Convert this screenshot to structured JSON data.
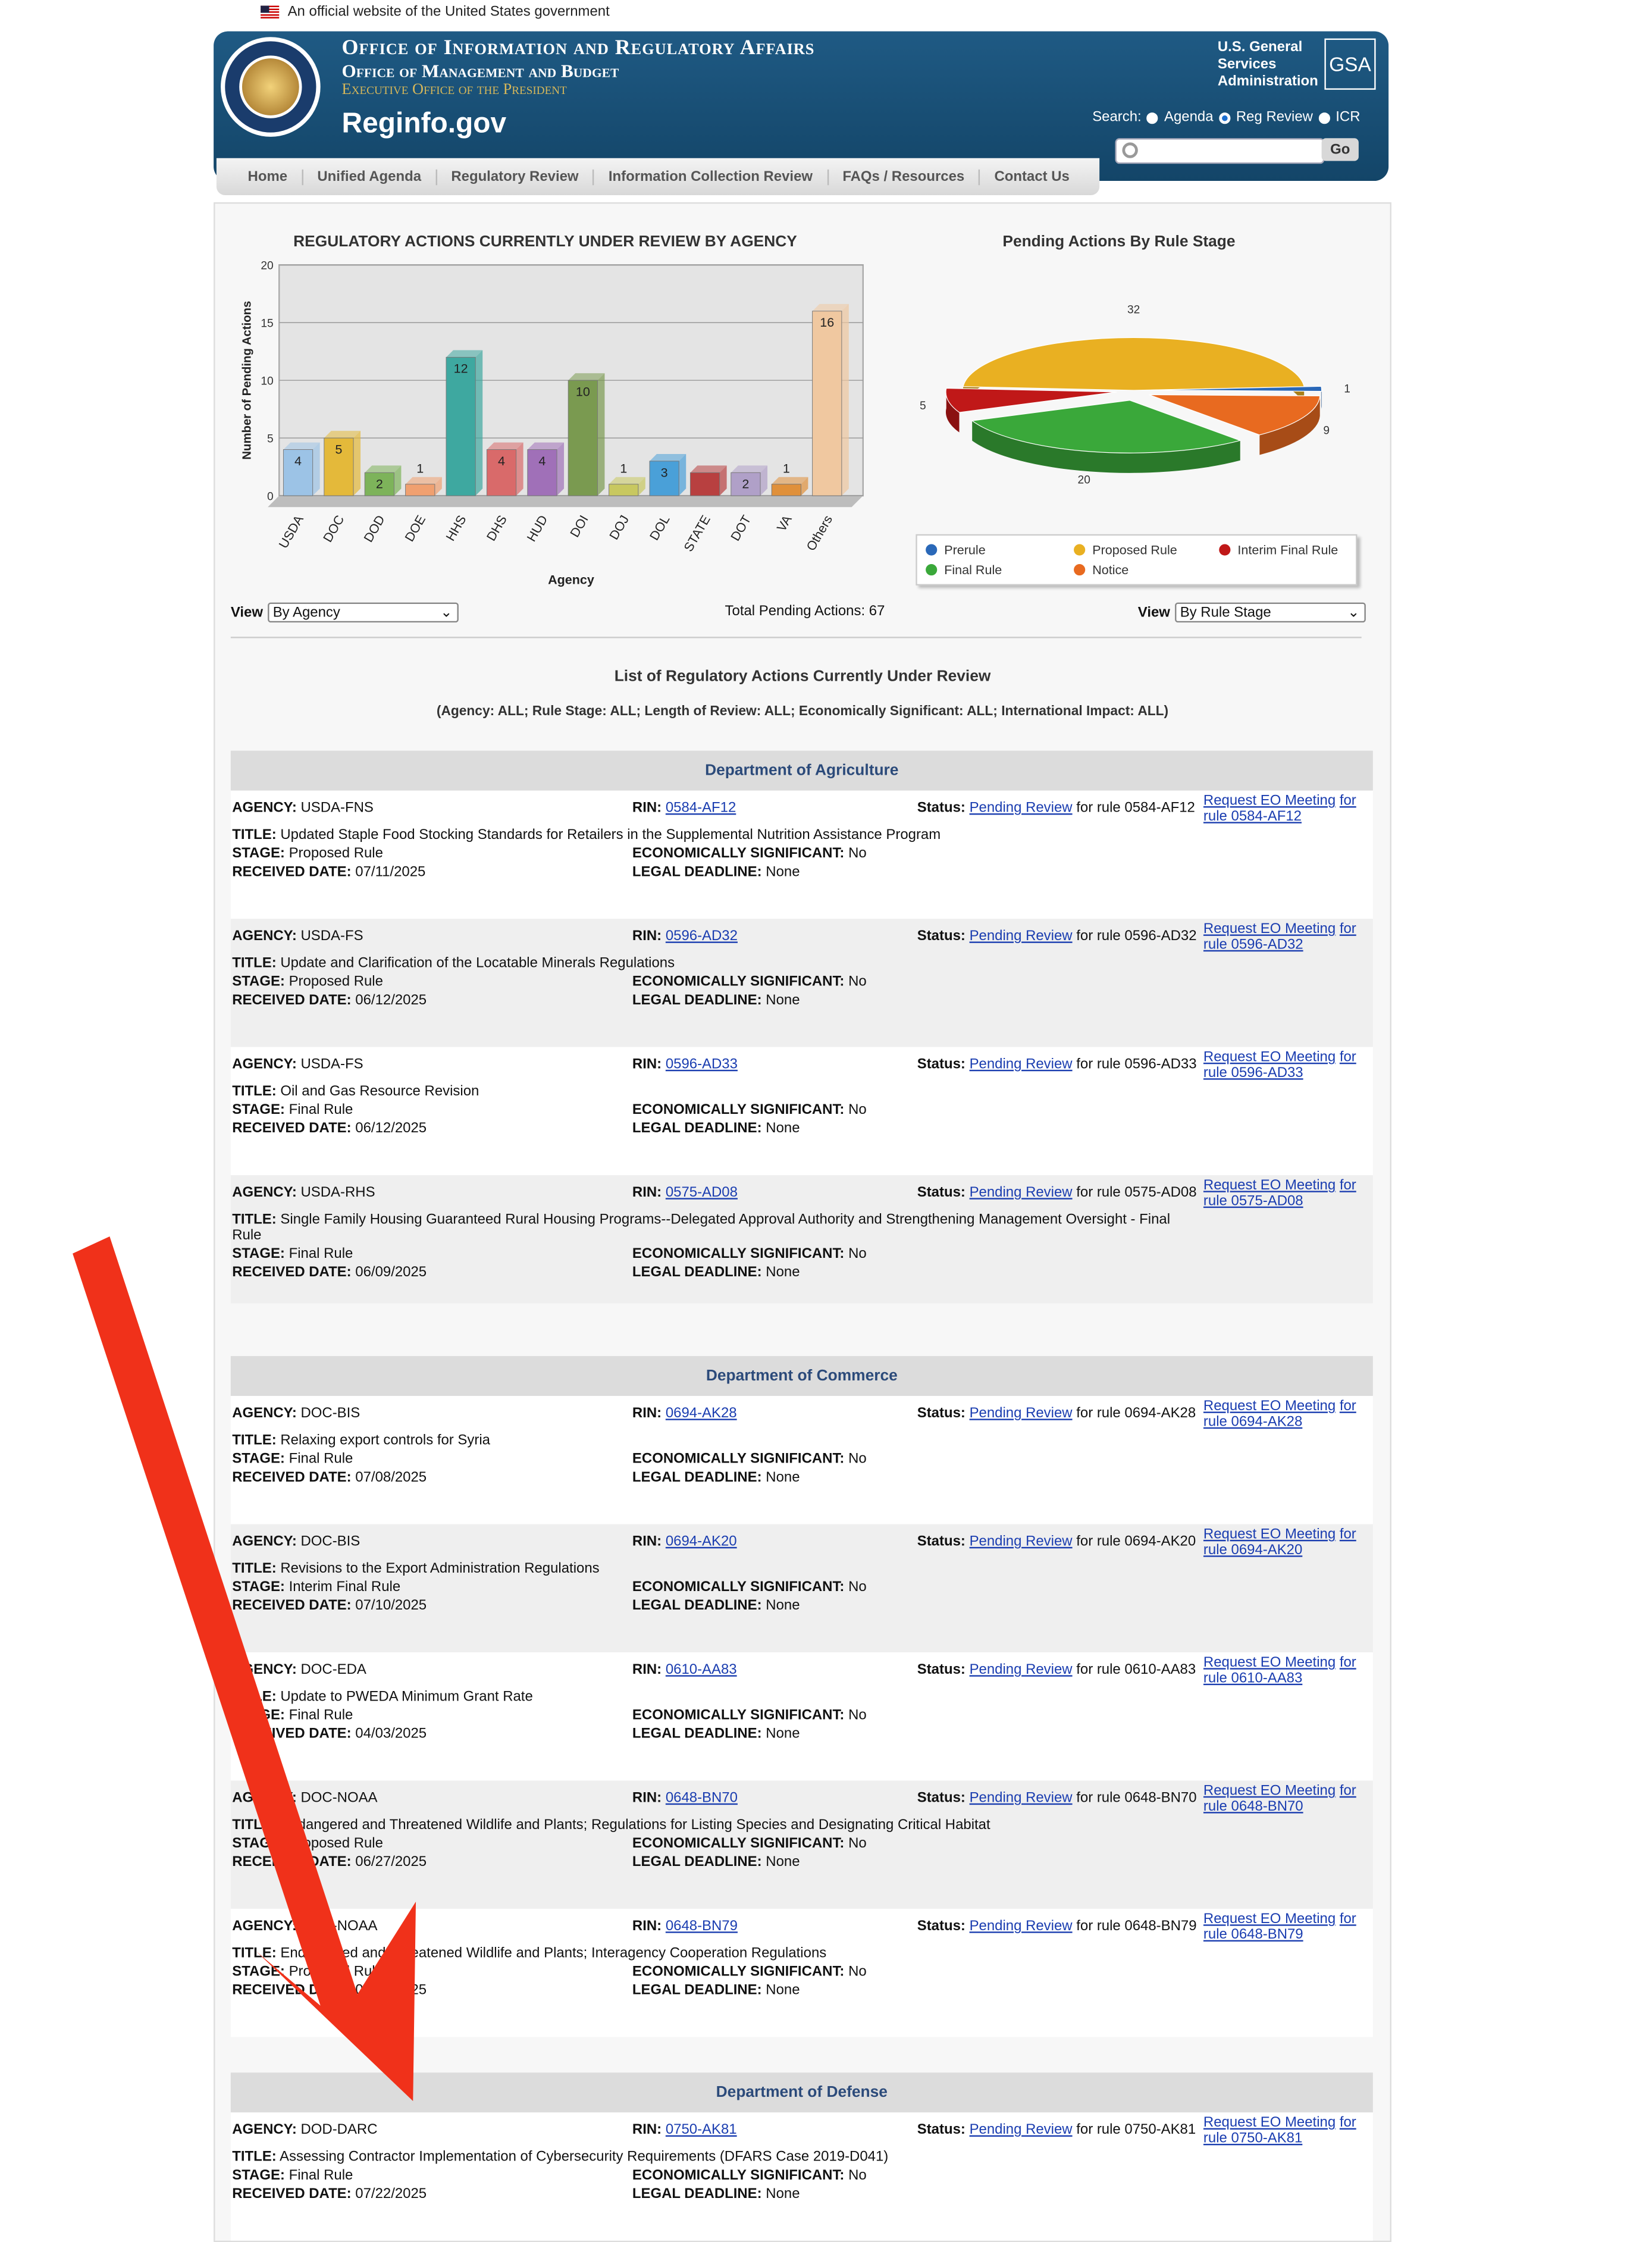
{
  "gov_banner": "An official website of the United States government",
  "header": {
    "title": "Office of Information and Regulatory Affairs",
    "subtitle": "Office of Management and Budget",
    "exec": "Executive Office of the President",
    "site": "Reginfo.gov",
    "gsa_text": "U.S. General Services Administration",
    "gsa_logo": "GSA",
    "search_label": "Search:",
    "search_options": [
      "Agenda",
      "Reg Review",
      "ICR"
    ],
    "search_selected": "Reg Review",
    "go_label": "Go"
  },
  "nav": [
    "Home",
    "Unified Agenda",
    "Regulatory Review",
    "Information Collection Review",
    "FAQs / Resources",
    "Contact Us"
  ],
  "bar_view": {
    "label": "View",
    "value": "By Agency"
  },
  "pie_view": {
    "label": "View",
    "value": "By Rule Stage"
  },
  "total_pending": "Total Pending Actions: 67",
  "chart_data": [
    {
      "type": "bar",
      "title": "REGULATORY ACTIONS CURRENTLY UNDER REVIEW BY AGENCY",
      "xlabel": "Agency",
      "ylabel": "Number of Pending Actions",
      "ylim": [
        0,
        20
      ],
      "yticks": [
        "0",
        "5",
        "10",
        "15",
        "20"
      ],
      "categories": [
        "USDA",
        "DOC",
        "DOD",
        "DOE",
        "HHS",
        "DHS",
        "HUD",
        "DOI",
        "DOJ",
        "DOL",
        "STATE",
        "DOT",
        "VA",
        "Others"
      ],
      "values": [
        4,
        5,
        2,
        1,
        12,
        4,
        4,
        10,
        1,
        3,
        2,
        2,
        1,
        16
      ],
      "labels": [
        "4",
        "5",
        "2",
        "1",
        "12",
        "4",
        "4",
        "10",
        "1",
        "3",
        "",
        "2",
        "1",
        "16"
      ],
      "colors": [
        "#9cc3e6",
        "#e4b93a",
        "#7db35a",
        "#f0a070",
        "#3ea8a0",
        "#d96a6a",
        "#a070b8",
        "#7a9a50",
        "#c8c860",
        "#4aa0d8",
        "#b84040",
        "#b0a0c8",
        "#e0903a",
        "#f0c8a0"
      ]
    },
    {
      "type": "pie",
      "title": "Pending Actions By Rule Stage",
      "slices": [
        {
          "label": "Proposed Rule",
          "value": 32,
          "color": "#e9b022"
        },
        {
          "label": "Prerule",
          "value": 1,
          "color": "#2a68b8"
        },
        {
          "label": "Notice",
          "value": 9,
          "color": "#e86a20"
        },
        {
          "label": "Final Rule",
          "value": 20,
          "color": "#3aa83a"
        },
        {
          "label": "Interim Final Rule",
          "value": 5,
          "color": "#c01818"
        }
      ],
      "value_labels": [
        "32",
        "1",
        "9",
        "20",
        "5"
      ],
      "legend": [
        "Prerule",
        "Proposed Rule",
        "Interim Final Rule",
        "Final Rule",
        "Notice"
      ]
    }
  ],
  "list_title": "List of Regulatory Actions Currently Under Review",
  "filters": "(Agency: ALL; Rule Stage: ALL; Length of Review: ALL; Economically Significant: ALL; International Impact: ALL)",
  "labels": {
    "agency": "AGENCY:",
    "rin": "RIN:",
    "status": "Status:",
    "pending": "Pending Review",
    "title": "TITLE:",
    "stage": "STAGE:",
    "received": "RECEIVED DATE:",
    "econ": "ECONOMICALLY SIGNIFICANT:",
    "legal": "LEGAL DEADLINE:",
    "request": "Request EO Meeting",
    "for": "for"
  },
  "departments": [
    {
      "name": "Department of Agriculture",
      "rows": [
        {
          "agency": "USDA-FNS",
          "rin": "0584-AF12",
          "status_suffix": "for rule 0584-AF12",
          "eo_rule": "rule 0584-AF12",
          "title": "Updated Staple Food Stocking Standards for Retailers in the Supplemental Nutrition Assistance Program",
          "title2": "",
          "stage": "Proposed Rule",
          "received": "07/11/2025",
          "econ": "No",
          "legal": "None"
        },
        {
          "agency": "USDA-FS",
          "rin": "0596-AD32",
          "status_suffix": "for rule 0596-AD32",
          "eo_rule": "rule 0596-AD32",
          "title": "Update and Clarification of the Locatable Minerals Regulations",
          "title2": "",
          "stage": "Proposed Rule",
          "received": "06/12/2025",
          "econ": "No",
          "legal": "None"
        },
        {
          "agency": "USDA-FS",
          "rin": "0596-AD33",
          "status_suffix": "for rule 0596-AD33",
          "eo_rule": "rule 0596-AD33",
          "title": "Oil and Gas Resource Revision",
          "title2": "",
          "stage": "Final Rule",
          "received": "06/12/2025",
          "econ": "No",
          "legal": "None"
        },
        {
          "agency": "USDA-RHS",
          "rin": "0575-AD08",
          "status_suffix": "for rule 0575-AD08",
          "eo_rule": "rule 0575-AD08",
          "title": "Single Family Housing Guaranteed Rural Housing Programs--Delegated Approval Authority and Strengthening Management Oversight - Final",
          "title2": "Rule",
          "stage": "Final Rule",
          "received": "06/09/2025",
          "econ": "No",
          "legal": "None"
        }
      ]
    },
    {
      "name": "Department of Commerce",
      "rows": [
        {
          "agency": "DOC-BIS",
          "rin": "0694-AK28",
          "status_suffix": "for rule 0694-AK28",
          "eo_rule": "rule 0694-AK28",
          "title": "Relaxing export controls for Syria",
          "title2": "",
          "stage": "Final Rule",
          "received": "07/08/2025",
          "econ": "No",
          "legal": "None"
        },
        {
          "agency": "DOC-BIS",
          "rin": "0694-AK20",
          "status_suffix": "for rule 0694-AK20",
          "eo_rule": "rule 0694-AK20",
          "title": "Revisions to the Export Administration Regulations",
          "title2": "",
          "stage": "Interim Final Rule",
          "received": "07/10/2025",
          "econ": "No",
          "legal": "None"
        },
        {
          "agency": "DOC-EDA",
          "rin": "0610-AA83",
          "status_suffix": "for rule 0610-AA83",
          "eo_rule": "rule 0610-AA83",
          "title": "Update to PWEDA Minimum Grant Rate",
          "title2": "",
          "stage": "Final Rule",
          "received": "04/03/2025",
          "econ": "No",
          "legal": "None"
        },
        {
          "agency": "DOC-NOAA",
          "rin": "0648-BN70",
          "status_suffix": "for rule 0648-BN70",
          "eo_rule": "rule 0648-BN70",
          "title": "Endangered and Threatened Wildlife and Plants; Regulations for Listing Species and Designating Critical Habitat",
          "title2": "",
          "stage": "Proposed Rule",
          "received": "06/27/2025",
          "econ": "No",
          "legal": "None"
        },
        {
          "agency": "DOC-NOAA",
          "rin": "0648-BN79",
          "status_suffix": "for rule 0648-BN79",
          "eo_rule": "rule 0648-BN79",
          "title": "Endangered and Threatened Wildlife and Plants; Interagency Cooperation Regulations",
          "title2": "",
          "stage": "Proposed Rule",
          "received": "06/27/2025",
          "econ": "No",
          "legal": "None"
        }
      ]
    },
    {
      "name": "Department of Defense",
      "rows": [
        {
          "agency": "DOD-DARC",
          "rin": "0750-AK81",
          "status_suffix": "for rule 0750-AK81",
          "eo_rule": "rule 0750-AK81",
          "title": "Assessing Contractor Implementation of Cybersecurity Requirements (DFARS Case 2019-D041)",
          "title2": "",
          "stage": "Final Rule",
          "received": "07/22/2025",
          "econ": "No",
          "legal": "None"
        }
      ]
    }
  ],
  "annotation_color": "#f0311a"
}
